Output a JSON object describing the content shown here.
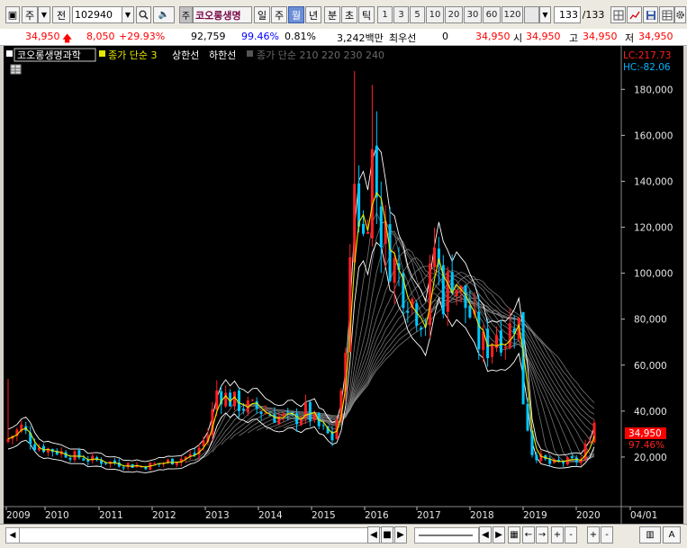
{
  "toolbar": {
    "period_label": "주",
    "period_dropdown_arrow": "▼",
    "prefix_label": "전",
    "code_value": "102940",
    "company_tag": "주",
    "company_name": "코오롱생명",
    "tabs": [
      "일",
      "주",
      "월",
      "년",
      "분",
      "초",
      "틱"
    ],
    "active_tab": "월",
    "numbers": [
      "1",
      "3",
      "5",
      "10",
      "20",
      "30",
      "60",
      "120"
    ],
    "count_value": "133",
    "count_total": "/133"
  },
  "quote": {
    "price": "34,950",
    "change": "8,050",
    "change_pct": "+29.93%",
    "volume": "92,759",
    "ratio": "99.46%",
    "turnover": "0.81%",
    "amount": "3,242백만",
    "pref_label": "최우선",
    "pref_value": "0",
    "current": "34,950",
    "open_label": "시",
    "open": "34,950",
    "high_label": "고",
    "high": "34,950",
    "low_label": "저",
    "low": "34,950",
    "colors": {
      "up": "#ff0000",
      "blue": "#0000ff",
      "black": "#000000"
    }
  },
  "chart": {
    "legend_name": "코오롱생명과학",
    "legend_ma": "종가 단순 3",
    "legend_upper": "상한선",
    "legend_lower": "하한선",
    "legend_ma_set": "종가 단순 210  220  230  240",
    "lc_label": "LC:217.73",
    "hc_label": "HC:-82.06",
    "last_price_label": "34,950",
    "last_change_label": "97.46%",
    "x_labels": [
      "2009",
      "2010",
      "2011",
      "2012",
      "2013",
      "2014",
      "2015",
      "2016",
      "2017",
      "2018",
      "2019",
      "2020",
      "04/01"
    ]
  },
  "chart_data": {
    "type": "candlestick",
    "y_ticks": [
      "180,000",
      "160,000",
      "140,000",
      "120,000",
      "100,000",
      "80,000",
      "60,000",
      "40,000",
      "20,000"
    ],
    "ylim": [
      0,
      195000
    ],
    "last_price": 34950,
    "x_ticks": [
      "2009",
      "2010",
      "2011",
      "2012",
      "2013",
      "2014",
      "2015",
      "2016",
      "2017",
      "2018",
      "2019",
      "2020",
      "04/01"
    ],
    "series": [
      {
        "name": "종가 단순 3",
        "color": "#e8e800"
      },
      {
        "name": "상한선",
        "color": "#ffffff"
      },
      {
        "name": "하한선",
        "color": "#ffffff"
      }
    ],
    "colors": {
      "up": "#ff2020",
      "down": "#00c8ff"
    }
  },
  "bottom": {
    "buttons": [
      "◀",
      "■",
      "▶",
      "◀",
      "▶",
      "←",
      "→",
      "+",
      "-",
      "+",
      "-",
      "A"
    ]
  }
}
